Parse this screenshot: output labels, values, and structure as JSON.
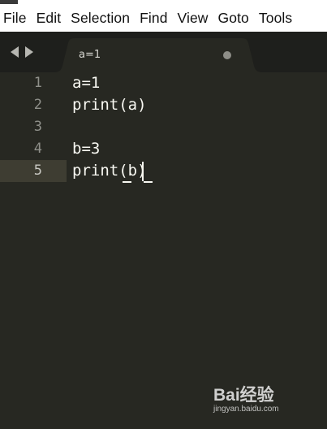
{
  "menu": {
    "items": [
      "File",
      "Edit",
      "Selection",
      "Find",
      "View",
      "Goto",
      "Tools"
    ]
  },
  "nav": {
    "back_icon": "triangle-left-icon",
    "forward_icon": "triangle-right-icon"
  },
  "tab": {
    "title": "a=1",
    "unsaved_indicator": "dirty-dot-icon"
  },
  "editor": {
    "active_line": 5,
    "lines": [
      {
        "number": "1",
        "text": "a=1"
      },
      {
        "number": "2",
        "text": "print(a)"
      },
      {
        "number": "3",
        "text": ""
      },
      {
        "number": "4",
        "text": "b=3"
      },
      {
        "number": "5",
        "text": "print(b)"
      }
    ]
  },
  "watermark": {
    "brand": "Bai经验",
    "url": "jingyan.baidu.com"
  },
  "colors": {
    "editor_bg": "#272822",
    "tabbar_bg": "#1e1f1c",
    "active_tab_bg": "#272822",
    "active_line_bg": "#3e3d32",
    "text": "#f8f8f2",
    "gutter_text": "#8f908a"
  }
}
